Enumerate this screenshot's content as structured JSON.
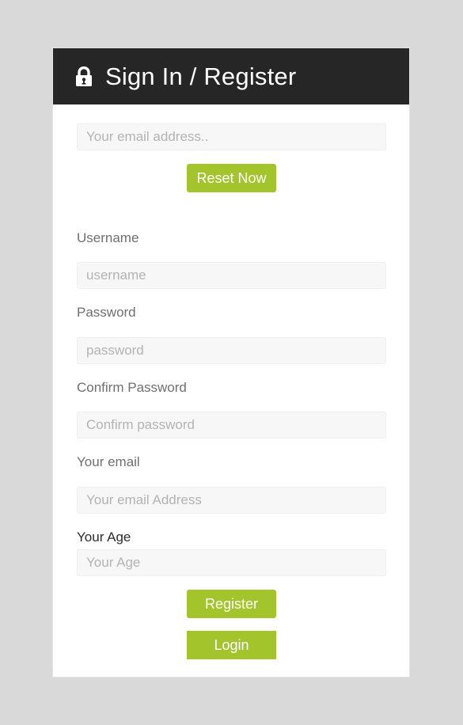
{
  "header": {
    "icon": "lock-icon",
    "title": "Sign In / Register"
  },
  "reset": {
    "email_placeholder": "Your email address..",
    "email_value": "",
    "button_label": "Reset Now"
  },
  "register_form": {
    "fields": [
      {
        "label": "Username",
        "placeholder": "username",
        "value": "",
        "type": "text"
      },
      {
        "label": "Password",
        "placeholder": "password",
        "value": "",
        "type": "password"
      },
      {
        "label": "Confirm Password",
        "placeholder": "Confirm password",
        "value": "",
        "type": "password"
      },
      {
        "label": "Your email",
        "placeholder": "Your email Address",
        "value": "",
        "type": "email"
      },
      {
        "label": "Your Age",
        "placeholder": "Your Age",
        "value": "",
        "type": "text"
      }
    ],
    "register_label": "Register",
    "login_label": "Login"
  },
  "colors": {
    "accent": "#a4c42c",
    "header_bg": "#262626",
    "page_bg": "#d9d9d9",
    "card_bg": "#ffffff",
    "input_bg": "#f7f7f7"
  }
}
